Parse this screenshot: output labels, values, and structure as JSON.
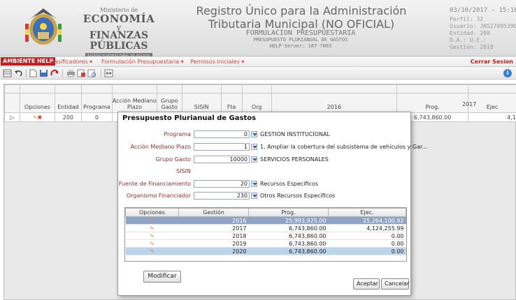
{
  "header": {
    "ministry_line1": "Ministerio de",
    "ministry_line2": "ECONOMÍA",
    "ministry_line3": "y",
    "ministry_line4": "FINANZAS PÚBLICAS",
    "ministry_line5": "ESTADO PLURINACIONAL DE BOLIVIA",
    "system_title": "Registro Único para la Administración Tributaria Municipal (NO OFICIAL)",
    "sub1": "FORMULACION PRESUPUESTARIA",
    "sub2": "PRESUPUESTO PLURIANUAL DE GASTOS",
    "sub3": "HELP-Server: 187-7003",
    "datetime": "03/10/2017 - 15:10",
    "perfil": "Perfil: 32",
    "usuario": "Usuario: JNS270953900",
    "entidad": "Entidad: 200",
    "da": "D.A.:  U.E.:",
    "gestion": "Gestión: 2018"
  },
  "menu": {
    "help_badge": "AMBIENTE HELP",
    "items": [
      "Clasificadores ▾",
      "Formulación Presupuestaria ▾",
      "Permisos Iniciales ▾"
    ],
    "logout": "Cerrar Sesion"
  },
  "grid": {
    "headers": {
      "opciones": "Opciones",
      "entidad": "Entidad",
      "programa": "Programa",
      "accion": "Acción Mediano Plazo",
      "grupo": "Grupo Gasto",
      "sisin": "SISIN",
      "fte": "Fte",
      "org": "Org",
      "y2016": "2016",
      "y2017": "2017",
      "prog": "Prog.",
      "ejec": "Ejec"
    },
    "row": {
      "entidad": "200",
      "programa": "0",
      "prog2017": "6,743,860.00",
      "ejec2017": "4,1"
    }
  },
  "dialog": {
    "title": "Presupuesto Plurianual de Gastos",
    "fields": [
      {
        "label": "Programa",
        "value": "0",
        "desc": "GESTIÓN INSTITUCIONAL"
      },
      {
        "label": "Acción Mediano Plazo",
        "value": "1",
        "desc": "1. Ampliar la cobertura del subsistema de vehículos y Gar..."
      },
      {
        "label": "Grupo Gasto",
        "value": "10000",
        "desc": "SERVICIOS PERSONALES"
      },
      {
        "label": "SISIN",
        "value": "",
        "desc": ""
      },
      {
        "label": "Fuente de Financiamiento",
        "value": "20",
        "desc": "Recursos Específicos"
      },
      {
        "label": "Organismo Financiador",
        "value": "230",
        "desc": "Otros Recursos Específicos"
      }
    ],
    "table": {
      "headers": [
        "Opciones",
        "Gestión",
        "Prog.",
        "Ejec."
      ],
      "rows": [
        {
          "gestion": "2016",
          "prog": "25,993,925.00",
          "ejec": "25,264,100.92"
        },
        {
          "gestion": "2017",
          "prog": "6,743,860.00",
          "ejec": "4,124,255.99"
        },
        {
          "gestion": "2018",
          "prog": "6,743,860.00",
          "ejec": "0.00"
        },
        {
          "gestion": "2019",
          "prog": "6,743,860.00",
          "ejec": "0.00"
        },
        {
          "gestion": "2020",
          "prog": "6,743,860.00",
          "ejec": "0.00"
        }
      ]
    },
    "buttons": {
      "modificar": "Modificar",
      "aceptar": "Aceptar",
      "cancelar": "Cancelar"
    }
  },
  "colors": {
    "accent_red": "#c21f1f",
    "menu_text": "#d04a4a",
    "selected_row": "#8fa3c7",
    "hover_row": "#bcd3ec",
    "info_blue": "#3a7fd5"
  }
}
